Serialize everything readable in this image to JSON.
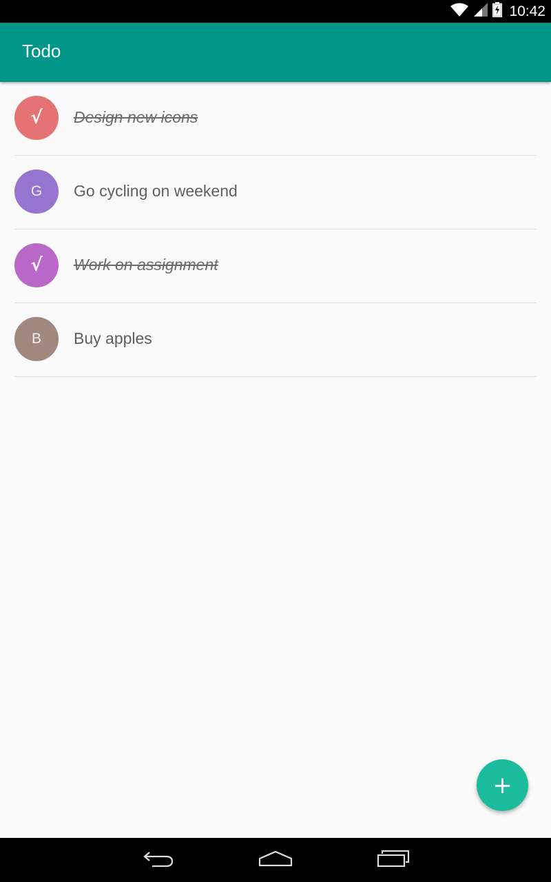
{
  "status_bar": {
    "time": "10:42",
    "icons": [
      "wifi-icon",
      "signal-icon",
      "battery-charging-icon"
    ]
  },
  "app_bar": {
    "title": "Todo",
    "color": "#009688"
  },
  "todos": [
    {
      "initial": "",
      "text": "Design new icons",
      "done": true,
      "avatar_color": "#e57373"
    },
    {
      "initial": "G",
      "text": "Go cycling on weekend",
      "done": false,
      "avatar_color": "#9575cd"
    },
    {
      "initial": "",
      "text": "Work on assignment",
      "done": true,
      "avatar_color": "#ba68c8"
    },
    {
      "initial": "B",
      "text": "Buy apples",
      "done": false,
      "avatar_color": "#a1887f"
    }
  ],
  "fab": {
    "icon": "plus-icon",
    "symbol": "+",
    "color": "#1abc9c"
  },
  "nav_bar": {
    "buttons": [
      "back-icon",
      "home-icon",
      "recents-icon"
    ]
  }
}
